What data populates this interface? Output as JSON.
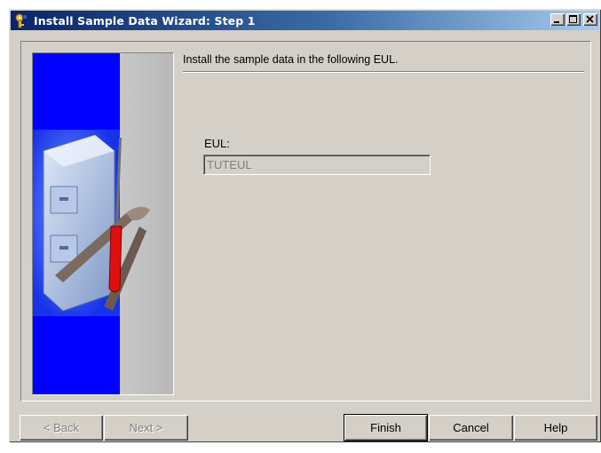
{
  "window": {
    "title": "Install Sample Data Wizard: Step 1",
    "controls": {
      "minimize": "_",
      "maximize": "□",
      "close": "X"
    }
  },
  "main": {
    "instruction": "Install the sample data in the following EUL.",
    "eul_label": "EUL:",
    "eul_value": "TUTEUL"
  },
  "buttons": {
    "back": "< Back",
    "next": "Next >",
    "finish": "Finish",
    "cancel": "Cancel",
    "help": "Help"
  },
  "icons": {
    "app": "wizard-key-icon",
    "graphic": "file-cabinet-tools-icon"
  },
  "colors": {
    "face": "#d4d0c8",
    "title_start": "#0a246a",
    "title_end": "#a6caf0",
    "graphic_blue": "#0000ff"
  }
}
